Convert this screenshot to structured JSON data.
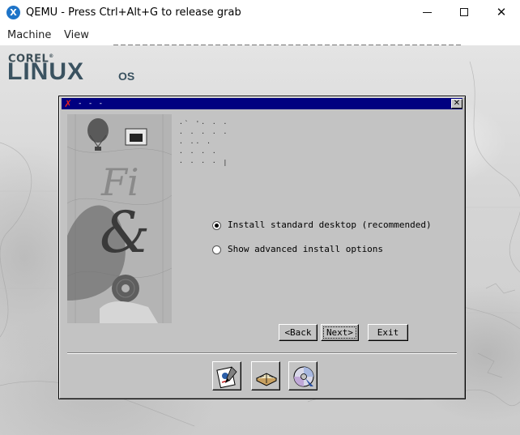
{
  "window": {
    "app_icon_glyph": "X",
    "title": "QEMU - Press Ctrl+Alt+G to release grab",
    "controls": {
      "close_glyph": "✕"
    }
  },
  "menubar": {
    "items": [
      "Machine",
      "View"
    ]
  },
  "desktop": {
    "logo": {
      "corel": "COREL",
      "registered": "®",
      "linux": "LINUX",
      "os": "OS"
    }
  },
  "dialog": {
    "title": "- - -",
    "close_glyph": "✕",
    "options": {
      "standard": {
        "label": "Install standard desktop (recommended)",
        "selected": true
      },
      "advanced": {
        "label": "Show advanced install options",
        "selected": false
      }
    },
    "buttons": {
      "back": "<Back",
      "next": "Next>",
      "exit": "Exit"
    },
    "toolbar_icons": [
      "certificate-icon",
      "book-icon",
      "cd-icon"
    ]
  },
  "colors": {
    "dialog_bg": "#c3c3c3",
    "title_bar": "#000080",
    "logo": "#3a5260"
  }
}
